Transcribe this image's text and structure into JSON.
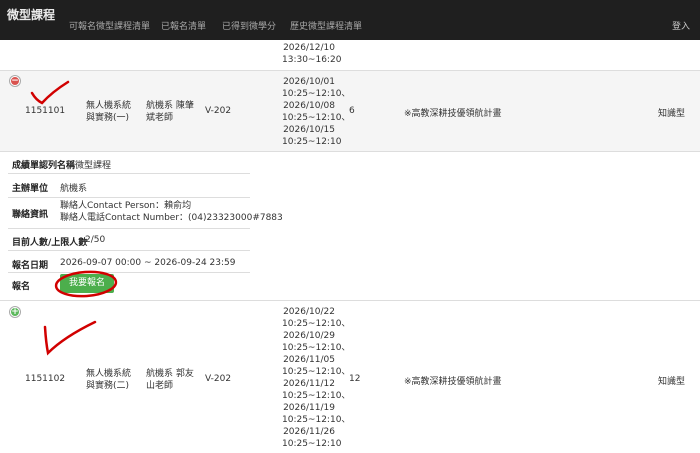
{
  "nav": {
    "brand": "微型課程",
    "links": [
      "可報名微型課程清單",
      "已報名清單",
      "已得到微學分",
      "歷史微型課程清單"
    ],
    "login": "登入"
  },
  "prev_row": {
    "date_lines": [
      "2026/12/10",
      "13:30~16:20"
    ]
  },
  "course1": {
    "code": "1151101",
    "name_lines": [
      "無人機系統",
      "與實務(一)"
    ],
    "teacher_lines": [
      "航機系 陳肇",
      "斌老師"
    ],
    "room": "V-202",
    "date_lines": [
      "2026/10/01",
      "10:25~12:10、",
      "2026/10/08",
      "10:25~12:10、",
      "2026/10/15",
      "10:25~12:10"
    ],
    "hours": "6",
    "program": "※高教深耕技優領航計畫",
    "type": "知識型"
  },
  "detail": {
    "cert_label": "成績單認列名稱",
    "cert_value": "微型課程",
    "unit_label": "主辦單位",
    "unit_value": "航機系",
    "contact_label": "聯絡資訊",
    "contact_lines": [
      "聯絡人Contact Person：賴俞均",
      "聯絡人電話Contact Number：(04)23323000#7883"
    ],
    "count_label": "目前人數/上限人數",
    "count_value": "2/50",
    "date_label": "報名日期",
    "date_value": "2026-09-07 00:00 ~ 2026-09-24 23:59",
    "enroll_label": "報名",
    "enroll_button": "我要報名"
  },
  "course2": {
    "code": "1151102",
    "name_lines": [
      "無人機系統",
      "與實務(二)"
    ],
    "teacher_lines": [
      "航機系 郭友",
      "山老師"
    ],
    "room": "V-202",
    "date_lines": [
      "2026/10/22",
      "10:25~12:10、",
      "2026/10/29",
      "10:25~12:10、",
      "2026/11/05",
      "10:25~12:10、",
      "2026/11/12",
      "10:25~12:10、",
      "2026/11/19",
      "10:25~12:10、",
      "2026/11/26",
      "10:25~12:10"
    ],
    "hours": "12",
    "program": "※高教深耕技優領航計畫",
    "type": "知識型"
  },
  "colors": {
    "navbar": "#1f1f1f",
    "collapse_icon": "#d9534f",
    "expand_icon": "#5cb85c",
    "enroll_button": "#4cae4c",
    "annotation": "#d10000"
  }
}
